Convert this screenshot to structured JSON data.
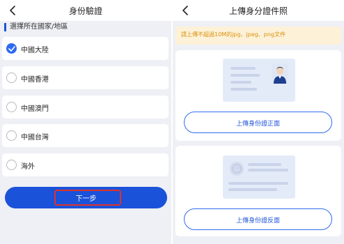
{
  "left_screen": {
    "title": "身份驗證",
    "section_label": "選擇所在國家/地區",
    "countries": [
      {
        "label": "中國大陸",
        "selected": true
      },
      {
        "label": "中國香港",
        "selected": false
      },
      {
        "label": "中國澳門",
        "selected": false
      },
      {
        "label": "中國台灣",
        "selected": false
      },
      {
        "label": "海外",
        "selected": false
      }
    ],
    "next_button": "下一步"
  },
  "right_screen": {
    "title": "上傳身分證件照",
    "notice": "請上傳不超過10M的jpg、jpeg、png文件",
    "front_button": "上傳身份證正面",
    "back_button": "上傳身份證反面"
  },
  "colors": {
    "accent": "#1a52d9",
    "highlight_border": "#e0322a",
    "notice_text": "#d9920f",
    "notice_bg": "#fdf1d8"
  },
  "icons": {
    "back": "chevron-left-icon",
    "check": "check-icon",
    "id_front": "id-card-front-icon",
    "id_back": "id-card-back-icon"
  }
}
